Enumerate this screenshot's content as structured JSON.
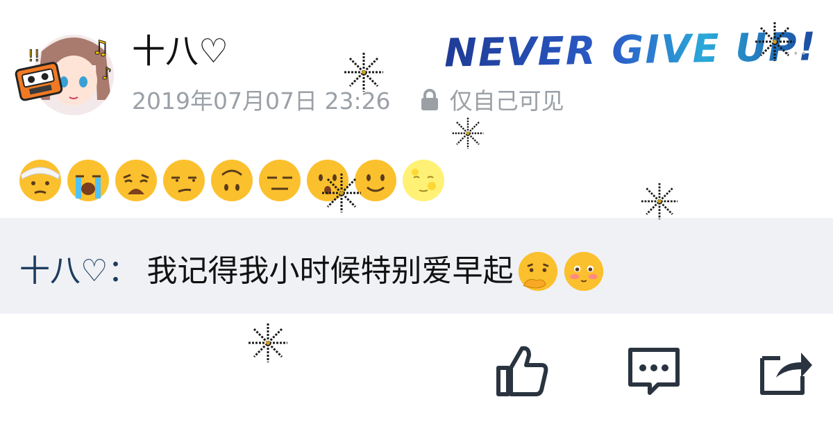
{
  "post": {
    "author": "十八♡",
    "timestamp": "2019年07月07日 23:26",
    "visibility": "仅自己可见",
    "banner_text": "NEVER GIVE UP!",
    "more_menu": "···",
    "emojis": [
      "head-bandage-face",
      "loudly-crying-face",
      "weary-face",
      "unamused-face",
      "upside-down-face",
      "expressionless-face",
      "hushed-face",
      "slightly-smiling-face",
      "full-moon-face"
    ]
  },
  "comment": {
    "author": "十八♡",
    "separator": "：",
    "text": "我记得我小时候特别爱早起",
    "emojis": [
      "thinking-face",
      "shy-face"
    ]
  },
  "actions": {
    "like": "thumbs-up-icon",
    "comment": "comment-icon",
    "share": "share-icon"
  },
  "colors": {
    "comment_bg": "#eff1f5",
    "author_link": "#1d3b5e",
    "meta_gray": "#9aa0a6",
    "icon_dark": "#2a3440"
  }
}
